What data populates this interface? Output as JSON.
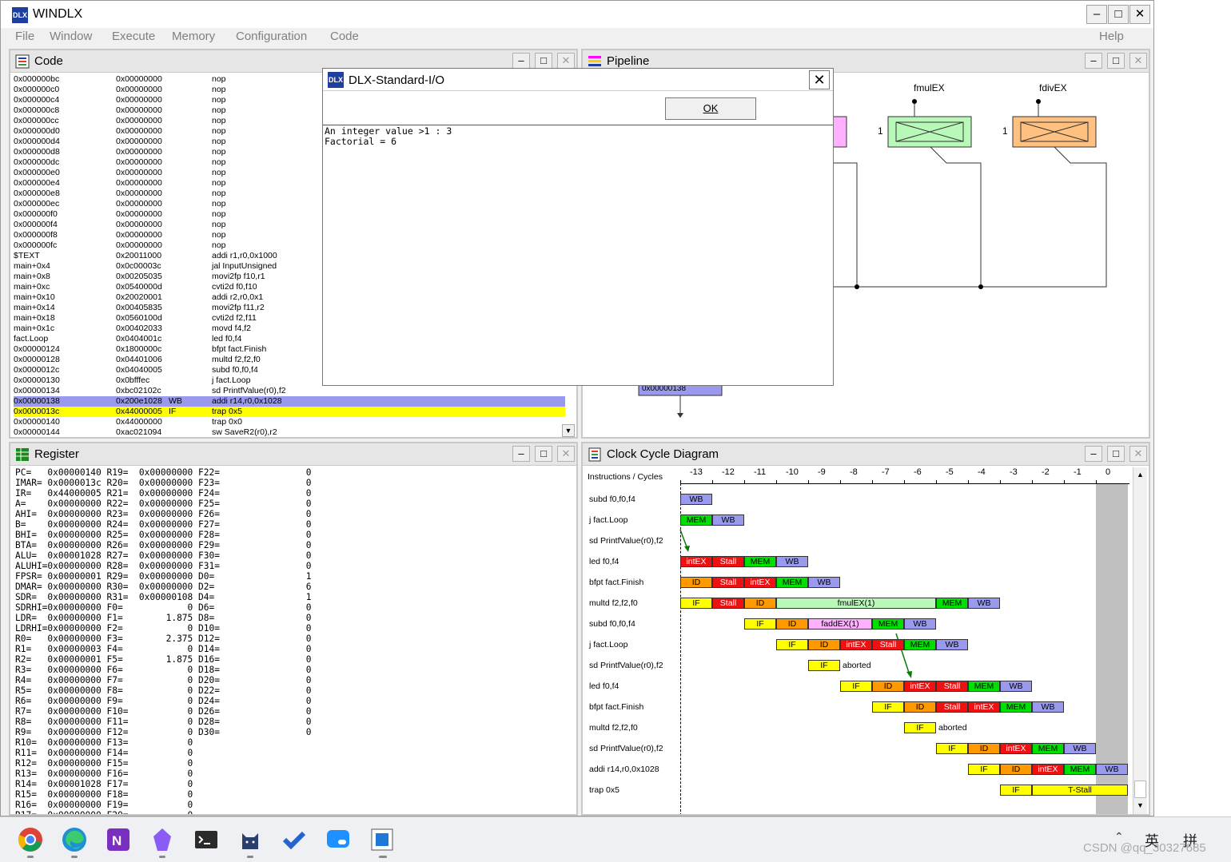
{
  "app": {
    "title": "WINDLX",
    "menu": [
      "File",
      "Window",
      "Execute",
      "Memory",
      "Configuration",
      "Code"
    ],
    "help": "Help"
  },
  "code_window": {
    "title": "Code",
    "rows": [
      [
        "0x000000bc",
        "0x00000000",
        "",
        "nop"
      ],
      [
        "0x000000c0",
        "0x00000000",
        "",
        "nop"
      ],
      [
        "0x000000c4",
        "0x00000000",
        "",
        "nop"
      ],
      [
        "0x000000c8",
        "0x00000000",
        "",
        "nop"
      ],
      [
        "0x000000cc",
        "0x00000000",
        "",
        "nop"
      ],
      [
        "0x000000d0",
        "0x00000000",
        "",
        "nop"
      ],
      [
        "0x000000d4",
        "0x00000000",
        "",
        "nop"
      ],
      [
        "0x000000d8",
        "0x00000000",
        "",
        "nop"
      ],
      [
        "0x000000dc",
        "0x00000000",
        "",
        "nop"
      ],
      [
        "0x000000e0",
        "0x00000000",
        "",
        "nop"
      ],
      [
        "0x000000e4",
        "0x00000000",
        "",
        "nop"
      ],
      [
        "0x000000e8",
        "0x00000000",
        "",
        "nop"
      ],
      [
        "0x000000ec",
        "0x00000000",
        "",
        "nop"
      ],
      [
        "0x000000f0",
        "0x00000000",
        "",
        "nop"
      ],
      [
        "0x000000f4",
        "0x00000000",
        "",
        "nop"
      ],
      [
        "0x000000f8",
        "0x00000000",
        "",
        "nop"
      ],
      [
        "0x000000fc",
        "0x00000000",
        "",
        "nop"
      ],
      [
        "$TEXT",
        "0x20011000",
        "",
        "addi r1,r0,0x1000"
      ],
      [
        "main+0x4",
        "0x0c00003c",
        "",
        "jal InputUnsigned"
      ],
      [
        "main+0x8",
        "0x00205035",
        "",
        "movi2fp f10,r1"
      ],
      [
        "main+0xc",
        "0x0540000d",
        "",
        "cvti2d f0,f10"
      ],
      [
        "main+0x10",
        "0x20020001",
        "",
        "addi r2,r0,0x1"
      ],
      [
        "main+0x14",
        "0x00405835",
        "",
        "movi2fp f11,r2"
      ],
      [
        "main+0x18",
        "0x0560100d",
        "",
        "cvti2d f2,f11"
      ],
      [
        "main+0x1c",
        "0x00402033",
        "",
        "movd f4,f2"
      ],
      [
        "fact.Loop",
        "0x0404001c",
        "",
        "led f0,f4"
      ],
      [
        "0x00000124",
        "0x1800000c",
        "",
        "bfpt fact.Finish"
      ],
      [
        "0x00000128",
        "0x04401006",
        "",
        "multd f2,f2,f0"
      ],
      [
        "0x0000012c",
        "0x04040005",
        "",
        "subd f0,f0,f4"
      ],
      [
        "0x00000130",
        "0x0bfffec",
        "",
        "j fact.Loop"
      ],
      [
        "0x00000134",
        "0xbc02102c",
        "",
        "sd PrintfValue(r0),f2"
      ],
      [
        "0x00000138",
        "0x200e1028",
        "WB",
        "addi r14,r0,0x1028"
      ],
      [
        "0x0000013c",
        "0x44000005",
        "IF",
        "trap 0x5"
      ],
      [
        "0x00000140",
        "0x44000000",
        "",
        "trap 0x0"
      ],
      [
        "0x00000144",
        "0xac021094",
        "",
        "sw SaveR2(r0),r2"
      ]
    ]
  },
  "pipeline_window": {
    "title": "Pipeline",
    "fmul_label": "fmulEX",
    "fdiv_label": "fdivEX",
    "fmul_count": "1",
    "fdiv_count": "1",
    "addr_box": "0x00000138"
  },
  "register_window": {
    "title": "Register",
    "lines": [
      "PC=   0x00000140 R19=  0x00000000 F22=                0",
      "IMAR= 0x0000013c R20=  0x00000000 F23=                0",
      "IR=   0x44000005 R21=  0x00000000 F24=                0",
      "A=    0x00000000 R22=  0x00000000 F25=                0",
      "AHI=  0x00000000 R23=  0x00000000 F26=                0",
      "B=    0x00000000 R24=  0x00000000 F27=                0",
      "BHI=  0x00000000 R25=  0x00000000 F28=                0",
      "BTA=  0x00000000 R26=  0x00000000 F29=                0",
      "ALU=  0x00001028 R27=  0x00000000 F30=                0",
      "ALUHI=0x00000000 R28=  0x00000000 F31=                0",
      "FPSR= 0x00000001 R29=  0x00000000 D0=                 1",
      "DMAR= 0x00000000 R30=  0x00000000 D2=                 6",
      "SDR=  0x00000000 R31=  0x00000108 D4=                 1",
      "SDRHI=0x00000000 F0=            0 D6=                 0",
      "LDR=  0x00000000 F1=        1.875 D8=                 0",
      "LDRHI=0x00000000 F2=            0 D10=                0",
      "R0=   0x00000000 F3=        2.375 D12=                0",
      "R1=   0x00000003 F4=            0 D14=                0",
      "R2=   0x00000001 F5=        1.875 D16=                0",
      "R3=   0x00000000 F6=            0 D18=                0",
      "R4=   0x00000000 F7=            0 D20=                0",
      "R5=   0x00000000 F8=            0 D22=                0",
      "R6=   0x00000000 F9=            0 D24=                0",
      "R7=   0x00000000 F10=           0 D26=                0",
      "R8=   0x00000000 F11=           0 D28=                0",
      "R9=   0x00000000 F12=           0 D30=                0",
      "R10=  0x00000000 F13=           0",
      "R11=  0x00000000 F14=           0",
      "R12=  0x00000000 F15=           0",
      "R13=  0x00000000 F16=           0",
      "R14=  0x00001028 F17=           0",
      "R15=  0x00000000 F18=           0",
      "R16=  0x00000000 F19=           0",
      "R17=  0x00000000 F20=           0"
    ]
  },
  "clock_window": {
    "title": "Clock Cycle Diagram",
    "header": "Instructions / Cycles",
    "cycles": [
      "-13",
      "-12",
      "-11",
      "-10",
      "-9",
      "-8",
      "-7",
      "-6",
      "-5",
      "-4",
      "-3",
      "-2",
      "-1",
      "0"
    ],
    "instructions": [
      "subd f0,f0,f4",
      "j fact.Loop",
      "sd PrintfValue(r0),f2",
      "led f0,f4",
      "bfpt fact.Finish",
      "multd f2,f2,f0",
      "subd f0,f0,f4",
      "j fact.Loop",
      "sd PrintfValue(r0),f2",
      "led f0,f4",
      "bfpt fact.Finish",
      "multd f2,f2,f0",
      "sd PrintfValue(r0),f2",
      "addi r14,r0,0x1028",
      "trap 0x5"
    ],
    "rows": [
      [
        {
          "s": 0,
          "n": 1,
          "t": "WB"
        }
      ],
      [
        {
          "s": 0,
          "n": 1,
          "t": "MEM"
        },
        {
          "s": 1,
          "n": 1,
          "t": "WB"
        }
      ],
      [],
      [
        {
          "s": 0,
          "n": 1,
          "t": "intEX"
        },
        {
          "s": 1,
          "n": 1,
          "t": "Stall"
        },
        {
          "s": 2,
          "n": 1,
          "t": "MEM"
        },
        {
          "s": 3,
          "n": 1,
          "t": "WB"
        }
      ],
      [
        {
          "s": 0,
          "n": 1,
          "t": "ID"
        },
        {
          "s": 1,
          "n": 1,
          "t": "Stall"
        },
        {
          "s": 2,
          "n": 1,
          "t": "intEX"
        },
        {
          "s": 3,
          "n": 1,
          "t": "MEM"
        },
        {
          "s": 4,
          "n": 1,
          "t": "WB"
        }
      ],
      [
        {
          "s": 0,
          "n": 1,
          "t": "IF"
        },
        {
          "s": 1,
          "n": 1,
          "t": "Stall"
        },
        {
          "s": 2,
          "n": 1,
          "t": "ID"
        },
        {
          "s": 3,
          "n": 5,
          "t": "fmulEX(1)"
        },
        {
          "s": 8,
          "n": 1,
          "t": "MEM"
        },
        {
          "s": 9,
          "n": 1,
          "t": "WB"
        }
      ],
      [
        {
          "s": 2,
          "n": 1,
          "t": "IF"
        },
        {
          "s": 3,
          "n": 1,
          "t": "ID"
        },
        {
          "s": 4,
          "n": 2,
          "t": "faddEX(1)"
        },
        {
          "s": 6,
          "n": 1,
          "t": "MEM"
        },
        {
          "s": 7,
          "n": 1,
          "t": "WB"
        }
      ],
      [
        {
          "s": 3,
          "n": 1,
          "t": "IF"
        },
        {
          "s": 4,
          "n": 1,
          "t": "ID"
        },
        {
          "s": 5,
          "n": 1,
          "t": "intEX"
        },
        {
          "s": 6,
          "n": 1,
          "t": "Stall"
        },
        {
          "s": 7,
          "n": 1,
          "t": "MEM"
        },
        {
          "s": 8,
          "n": 1,
          "t": "WB"
        }
      ],
      [
        {
          "s": 4,
          "n": 1,
          "t": "IF"
        },
        {
          "s": 5,
          "n": 1,
          "t": "aborted"
        }
      ],
      [
        {
          "s": 5,
          "n": 1,
          "t": "IF"
        },
        {
          "s": 6,
          "n": 1,
          "t": "ID"
        },
        {
          "s": 7,
          "n": 1,
          "t": "intEX"
        },
        {
          "s": 8,
          "n": 1,
          "t": "Stall"
        },
        {
          "s": 9,
          "n": 1,
          "t": "MEM"
        },
        {
          "s": 10,
          "n": 1,
          "t": "WB"
        }
      ],
      [
        {
          "s": 6,
          "n": 1,
          "t": "IF"
        },
        {
          "s": 7,
          "n": 1,
          "t": "ID"
        },
        {
          "s": 8,
          "n": 1,
          "t": "Stall"
        },
        {
          "s": 9,
          "n": 1,
          "t": "intEX"
        },
        {
          "s": 10,
          "n": 1,
          "t": "MEM"
        },
        {
          "s": 11,
          "n": 1,
          "t": "WB"
        }
      ],
      [
        {
          "s": 7,
          "n": 1,
          "t": "IF"
        },
        {
          "s": 8,
          "n": 1,
          "t": "aborted"
        }
      ],
      [
        {
          "s": 8,
          "n": 1,
          "t": "IF"
        },
        {
          "s": 9,
          "n": 1,
          "t": "ID"
        },
        {
          "s": 10,
          "n": 1,
          "t": "intEX"
        },
        {
          "s": 11,
          "n": 1,
          "t": "MEM"
        },
        {
          "s": 12,
          "n": 1,
          "t": "WB"
        }
      ],
      [
        {
          "s": 9,
          "n": 1,
          "t": "IF"
        },
        {
          "s": 10,
          "n": 1,
          "t": "ID"
        },
        {
          "s": 11,
          "n": 1,
          "t": "intEX"
        },
        {
          "s": 12,
          "n": 1,
          "t": "MEM"
        },
        {
          "s": 13,
          "n": 1,
          "t": "WB"
        }
      ],
      [
        {
          "s": 10,
          "n": 1,
          "t": "IF"
        },
        {
          "s": 11,
          "n": 3,
          "t": "T-Stall"
        }
      ]
    ]
  },
  "dialog": {
    "title": "DLX-Standard-I/O",
    "ok_label": "OK",
    "output": "An integer value >1 : 3\nFactorial = 6"
  },
  "taskbar": {
    "tray_ime1": "英",
    "tray_ime2": "拼",
    "watermark": "CSDN @qq_30327685"
  },
  "colors": {
    "IF": "#ffff00",
    "ID": "#ff9900",
    "intEX": "#ee1111",
    "Stall": "#ee1111",
    "MEM": "#00e000",
    "WB": "#9999ee",
    "fmulEX(1)": "#b8f8b8",
    "faddEX(1)": "#ffb0ff",
    "T-Stall": "#ffff00"
  }
}
